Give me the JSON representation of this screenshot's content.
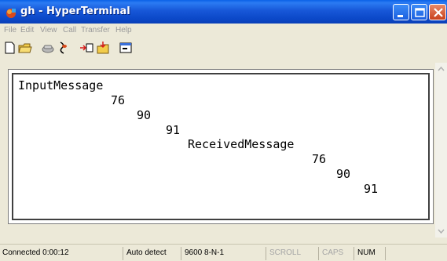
{
  "window": {
    "title": "gh - HyperTerminal",
    "app_icon": "hyperterminal-icon",
    "controls": [
      "minimize-icon",
      "maximize-icon",
      "close-icon"
    ]
  },
  "menu": {
    "items": [
      "File",
      "Edit",
      "View",
      "Call",
      "Transfer",
      "Help"
    ]
  },
  "toolbar": {
    "buttons": [
      "new-icon",
      "open-icon",
      "connect-icon",
      "disconnect-icon",
      "send-icon",
      "receive-icon",
      "properties-icon"
    ]
  },
  "terminal": {
    "lines": [
      "InputMessage",
      "76",
      "90",
      "91",
      "ReceivedMessage",
      "76",
      "90",
      "91"
    ]
  },
  "status": {
    "connected": "Connected 0:00:12",
    "detect": "Auto detect",
    "settings": "9600 8-N-1",
    "scroll": "SCROLL",
    "caps": "CAPS",
    "num": "NUM"
  },
  "colors": {
    "titlebar": "#0a52d8",
    "window_bg": "#ece9d8",
    "close_button": "#c9401b"
  }
}
